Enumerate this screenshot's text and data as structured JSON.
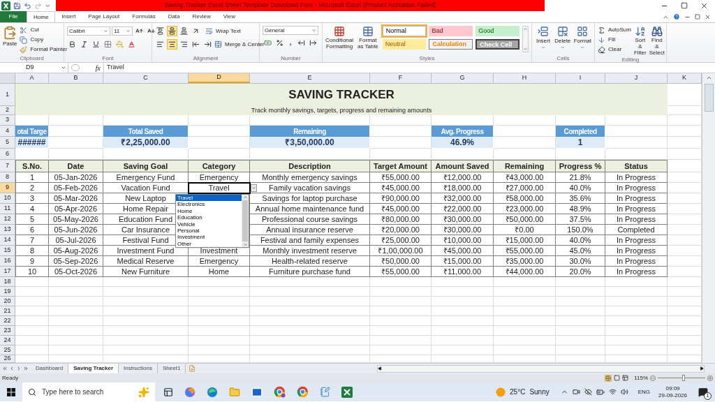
{
  "window": {
    "title": "Saving Tracker Excel Sheet Template Download Free  -  Microsoft Excel (Product Activation Failed)"
  },
  "tabs": [
    {
      "label": "File",
      "selected": false
    },
    {
      "label": "Home",
      "selected": true
    },
    {
      "label": "Insert",
      "selected": false
    },
    {
      "label": "Page Layout",
      "selected": false
    },
    {
      "label": "Formulas",
      "selected": false
    },
    {
      "label": "Data",
      "selected": false
    },
    {
      "label": "Review",
      "selected": false
    },
    {
      "label": "View",
      "selected": false
    }
  ],
  "ribbon": {
    "clipboard": {
      "label": "Clipboard",
      "paste": "Paste",
      "cut": "Cut",
      "copy": "Copy",
      "format_painter": "Format Painter"
    },
    "font": {
      "label": "Font",
      "name": "Calibri",
      "size": "11"
    },
    "alignment": {
      "label": "Alignment",
      "vertical_align": [
        {
          "selected": false
        },
        {
          "selected": true
        },
        {
          "selected": false
        }
      ],
      "horizontal_align": [
        {
          "selected": false
        },
        {
          "selected": true
        },
        {
          "selected": false
        }
      ],
      "wrap_text": "Wrap Text",
      "merge": "Merge & Center"
    },
    "number": {
      "label": "Number",
      "format": "General",
      "comma": ","
    },
    "styles": {
      "label": "Styles",
      "conditional": "Conditional Formatting",
      "format_table": "Format as Table",
      "cell_styles": [
        {
          "label": "Normal",
          "kind": "normal",
          "selected": true
        },
        {
          "label": "Bad",
          "kind": "bad",
          "selected": false
        },
        {
          "label": "Good",
          "kind": "good",
          "selected": false
        },
        {
          "label": "Neutral",
          "kind": "neutral",
          "selected": false
        },
        {
          "label": "Calculation",
          "kind": "calculation",
          "selected": false
        },
        {
          "label": "Check Cell",
          "kind": "check",
          "selected": false
        }
      ]
    },
    "cells": {
      "label": "Cells",
      "insert": "Insert",
      "delete": "Delete",
      "format": "Format"
    },
    "editing": {
      "label": "Editing",
      "autosum": "AutoSum",
      "fill": "Fill",
      "clear": "Clear",
      "sort": "Sort & Filter",
      "find": "Find & Select"
    }
  },
  "formula_bar": {
    "name_box": "D9",
    "function_label": "fx",
    "value": "Travel"
  },
  "columns": [
    {
      "label": "A",
      "selected": false
    },
    {
      "label": "B",
      "selected": false
    },
    {
      "label": "C",
      "selected": false
    },
    {
      "label": "D",
      "selected": true
    },
    {
      "label": "E",
      "selected": false
    },
    {
      "label": "F",
      "selected": false
    },
    {
      "label": "G",
      "selected": false
    },
    {
      "label": "H",
      "selected": false
    },
    {
      "label": "I",
      "selected": false
    },
    {
      "label": "J",
      "selected": false
    },
    {
      "label": "K",
      "selected": false
    }
  ],
  "rows": [
    {
      "label": "1",
      "selected": false
    },
    {
      "label": "2",
      "selected": false
    },
    {
      "label": "3",
      "selected": false
    },
    {
      "label": "4",
      "selected": false
    },
    {
      "label": "5",
      "selected": false
    },
    {
      "label": "6",
      "selected": false
    },
    {
      "label": "7",
      "selected": false
    },
    {
      "label": "8",
      "selected": false
    },
    {
      "label": "9",
      "selected": true
    },
    {
      "label": "10",
      "selected": false
    },
    {
      "label": "11",
      "selected": false
    },
    {
      "label": "12",
      "selected": false
    },
    {
      "label": "13",
      "selected": false
    },
    {
      "label": "14",
      "selected": false
    },
    {
      "label": "15",
      "selected": false
    },
    {
      "label": "16",
      "selected": false
    },
    {
      "label": "17",
      "selected": false
    },
    {
      "label": "18",
      "selected": false
    },
    {
      "label": "19",
      "selected": false
    },
    {
      "label": "20",
      "selected": false
    },
    {
      "label": "21",
      "selected": false
    },
    {
      "label": "22",
      "selected": false
    },
    {
      "label": "23",
      "selected": false
    },
    {
      "label": "24",
      "selected": false
    },
    {
      "label": "25",
      "selected": false
    },
    {
      "label": "26",
      "selected": false
    }
  ],
  "sheet": {
    "title": "SAVING TRACKER",
    "subtitle": "Track monthly savings, targets, progress and remaining amounts",
    "cards": [
      {
        "label": "otal Targe",
        "value": "######"
      },
      {
        "label": "Total Saved",
        "value": "₹2,25,000.00"
      },
      {
        "label": "Remaining",
        "value": "₹3,50,000.00"
      },
      {
        "label": "Avg. Progress",
        "value": "46.9%"
      },
      {
        "label": "Completed",
        "value": "1"
      }
    ],
    "table": {
      "headers": [
        "S.No.",
        "Date",
        "Saving Goal",
        "Category",
        "Description",
        "Target Amount",
        "Amount Saved",
        "Remaining",
        "Progress %",
        "Status"
      ],
      "rows": [
        [
          "1",
          "05-Jan-2026",
          "Emergency Fund",
          "Emergency",
          "Monthly emergency savings",
          "₹55,000.00",
          "₹12,000.00",
          "₹43,000.00",
          "21.8%",
          "In Progress"
        ],
        [
          "2",
          "05-Feb-2026",
          "Vacation Fund",
          "Travel",
          "Family vacation savings",
          "₹45,000.00",
          "₹18,000.00",
          "₹27,000.00",
          "40.0%",
          "In Progress"
        ],
        [
          "3",
          "05-Mar-2026",
          "New Laptop",
          null,
          "Savings for laptop purchase",
          "₹90,000.00",
          "₹32,000.00",
          "₹58,000.00",
          "35.6%",
          "In Progress"
        ],
        [
          "4",
          "05-Apr-2026",
          "Home Repair",
          null,
          "Annual home maintenance fund",
          "₹45,000.00",
          "₹22,000.00",
          "₹23,000.00",
          "48.9%",
          "In Progress"
        ],
        [
          "5",
          "05-May-2026",
          "Education Fund",
          null,
          "Professional course savings",
          "₹80,000.00",
          "₹30,000.00",
          "₹50,000.00",
          "37.5%",
          "In Progress"
        ],
        [
          "6",
          "05-Jun-2026",
          "Car Insurance",
          null,
          "Annual insurance reserve",
          "₹20,000.00",
          "₹30,000.00",
          "₹0.00",
          "150.0%",
          "Completed"
        ],
        [
          "7",
          "05-Jul-2026",
          "Festival Fund",
          null,
          "Festival and family expenses",
          "₹25,000.00",
          "₹10,000.00",
          "₹15,000.00",
          "40.0%",
          "In Progress"
        ],
        [
          "8",
          "05-Aug-2026",
          "Investment Fund",
          "Investment",
          "Monthly investment reserve",
          "₹1,00,000.00",
          "₹45,000.00",
          "₹55,000.00",
          "45.0%",
          "In Progress"
        ],
        [
          "9",
          "05-Sep-2026",
          "Medical Reserve",
          "Emergency",
          "Health-related reserve",
          "₹50,000.00",
          "₹15,000.00",
          "₹35,000.00",
          "30.0%",
          "In Progress"
        ],
        [
          "10",
          "05-Oct-2026",
          "New Furniture",
          "Home",
          "Furniture purchase fund",
          "₹55,000.00",
          "₹11,000.00",
          "₹44,000.00",
          "20.0%",
          "In Progress"
        ]
      ]
    },
    "dropdown": {
      "options": [
        {
          "label": "Travel",
          "selected": true
        },
        {
          "label": "Electronics",
          "selected": false
        },
        {
          "label": "Home",
          "selected": false
        },
        {
          "label": "Education",
          "selected": false
        },
        {
          "label": "Vehicle",
          "selected": false
        },
        {
          "label": "Personal",
          "selected": false
        },
        {
          "label": "Investment",
          "selected": false
        },
        {
          "label": "Other",
          "selected": false
        }
      ]
    }
  },
  "sheet_tabs": [
    {
      "label": "Dashboard",
      "selected": false
    },
    {
      "label": "Saving Tracker",
      "selected": true
    },
    {
      "label": "Instructions",
      "selected": false
    },
    {
      "label": "Sheet1",
      "selected": false
    }
  ],
  "status_bar": {
    "status": "Ready",
    "zoom": "115%",
    "zoom_slider": {
      "level": 0.55
    }
  },
  "taskbar": {
    "search_placeholder": "Type here to search",
    "temperature": "25°C",
    "weather": "Sunny",
    "language": "ENG",
    "time": "09:09",
    "date": "29-09-2026",
    "notifications": "1"
  }
}
